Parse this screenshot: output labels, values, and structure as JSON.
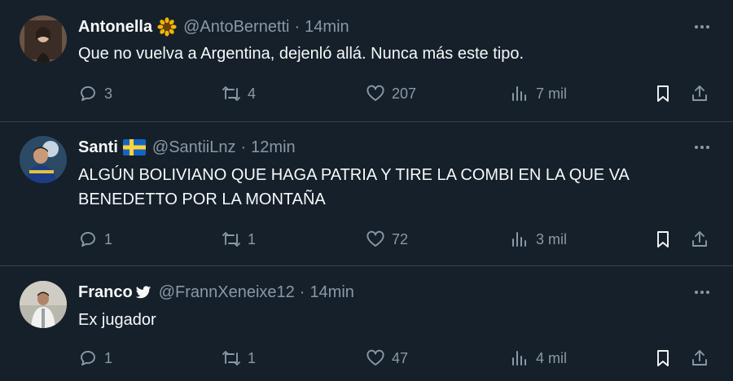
{
  "tweets": [
    {
      "name": "Antonella",
      "badge": "sunflower-emoji",
      "handle": "@AntoBernetti",
      "dot": "·",
      "time": "14min",
      "text": "Que no vuelva a Argentina, dejenló allá. Nunca más este tipo.",
      "replies": "3",
      "retweets": "4",
      "likes": "207",
      "views": "7 mil"
    },
    {
      "name": "Santi",
      "badge": "sweden-flag",
      "handle": "@SantiiLnz",
      "dot": "·",
      "time": "12min",
      "text": "ALGÚN BOLIVIANO QUE HAGA PATRIA Y TIRE LA COMBI EN LA QUE VA BENEDETTO POR LA MONTAÑA",
      "replies": "1",
      "retweets": "1",
      "likes": "72",
      "views": "3 mil"
    },
    {
      "name": "Franco",
      "badge": "bird-icon",
      "handle": "@FrannXeneixe12",
      "dot": "·",
      "time": "14min",
      "text": "Ex jugador",
      "replies": "1",
      "retweets": "1",
      "likes": "47",
      "views": "4 mil"
    }
  ],
  "colors": {
    "background": "#15202b",
    "divider": "#38444d",
    "text": "#f7f9f9",
    "muted": "#8b98a5"
  }
}
